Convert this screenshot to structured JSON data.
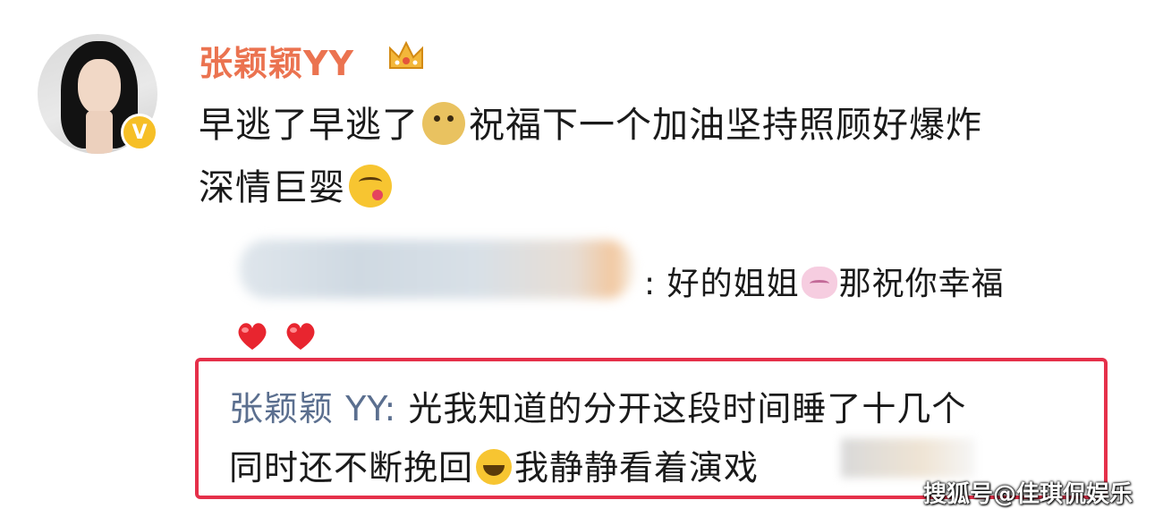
{
  "author": {
    "name": "张颖颖YY",
    "avatar_icon": "avatar",
    "verified_icon": "verified-badge-icon",
    "crown_icon": "crown-icon"
  },
  "post": {
    "line1_a": "早逃了早逃了",
    "line1_b": "祝福下一个加油坚持照顾好爆炸",
    "line2": "深情巨婴",
    "emoji_1": "doge-emoji-icon",
    "emoji_2": "yum-emoji-icon"
  },
  "reply": {
    "colon": ":",
    "text_a": "好的姐姐",
    "text_b": "那祝你幸福",
    "emoji": "bunny-emoji-icon",
    "hearts": [
      "heart-icon",
      "heart-icon"
    ]
  },
  "quoted_reply": {
    "author": "张颖颖 YY:",
    "line1": "光我知道的分开这段时间睡了十几个",
    "line2_a": "同时还不断挽回",
    "line2_b": "我静静看着演戏",
    "emoji": "laugh-emoji-icon",
    "border_color": "#e5304a"
  },
  "watermark": "搜狐号@佳琪侃娱乐",
  "colors": {
    "username": "#eb7350",
    "quote_author": "#5b6f8f",
    "verified": "#f6bf26",
    "heart": "#e8252f"
  }
}
